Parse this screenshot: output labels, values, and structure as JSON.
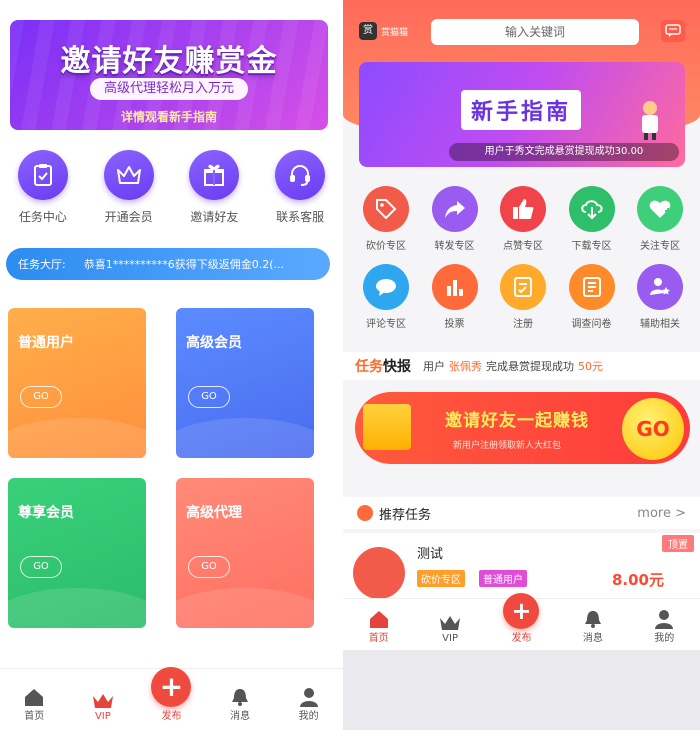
{
  "left": {
    "banner": {
      "title": "邀请好友赚赏金",
      "subtitle": "高级代理轻松月入万元",
      "hint": "详情观看新手指南"
    },
    "features": [
      {
        "label": "任务中心",
        "icon": "clipboard-icon"
      },
      {
        "label": "开通会员",
        "icon": "crown-icon"
      },
      {
        "label": "邀请好友",
        "icon": "gift-icon"
      },
      {
        "label": "联系客服",
        "icon": "headset-icon"
      }
    ],
    "ticker": {
      "label": "任务大厅:",
      "text": "恭喜1**********6获得下级返佣金0.2(..."
    },
    "cards": [
      {
        "title": "普通用户",
        "button": "GO"
      },
      {
        "title": "高级会员",
        "button": "GO"
      },
      {
        "title": "尊享会员",
        "button": "GO"
      },
      {
        "title": "高级代理",
        "button": "GO"
      }
    ],
    "tabbar": [
      {
        "label": "首页",
        "icon": "home-icon"
      },
      {
        "label": "VIP",
        "icon": "crown-icon"
      },
      {
        "label": "发布",
        "icon": "plus-icon"
      },
      {
        "label": "消息",
        "icon": "bell-icon"
      },
      {
        "label": "我的",
        "icon": "user-icon"
      }
    ]
  },
  "right": {
    "header": {
      "logo_badge": "赏",
      "logo_text": "赏猫猫",
      "search_placeholder": "输入关键词"
    },
    "banner": {
      "title": "新手指南",
      "notice": "用户于秀文完成悬赏提现成功30.00"
    },
    "categories_row1": [
      {
        "label": "砍价专区",
        "icon": "tag-icon",
        "color": "#f25a4a"
      },
      {
        "label": "转发专区",
        "icon": "share-icon",
        "color": "#9a5cf0"
      },
      {
        "label": "点赞专区",
        "icon": "thumbs-up-icon",
        "color": "#f0434a"
      },
      {
        "label": "下载专区",
        "icon": "download-icon",
        "color": "#2fbf6a"
      },
      {
        "label": "关注专区",
        "icon": "heart-plus-icon",
        "color": "#3fcf7a"
      }
    ],
    "categories_row2": [
      {
        "label": "评论专区",
        "icon": "comment-icon",
        "color": "#2fa7f0"
      },
      {
        "label": "投票",
        "icon": "bar-chart-icon",
        "color": "#ff6a3a"
      },
      {
        "label": "注册",
        "icon": "form-icon",
        "color": "#ffaa2a"
      },
      {
        "label": "调查问卷",
        "icon": "survey-icon",
        "color": "#ff8a2a"
      },
      {
        "label": "辅助相关",
        "icon": "star-user-icon",
        "color": "#9a5cf0"
      }
    ],
    "express": {
      "title_a": "任务",
      "title_b": "快报",
      "user_label": "用户",
      "user_name": "张佩秀",
      "message": "完成悬赏提现成功",
      "amount": "50元"
    },
    "invite": {
      "text": "邀请好友一起赚钱",
      "sub": "新用户注册领取新人大红包",
      "go": "GO"
    },
    "recommend": {
      "title": "推荐任务",
      "more": "more >"
    },
    "task": {
      "name": "测试",
      "tag1": "砍价专区",
      "tag2": "普通用户",
      "price": "8.00元",
      "top": "顶置"
    },
    "tabbar": [
      {
        "label": "首页",
        "icon": "home-icon"
      },
      {
        "label": "VIP",
        "icon": "crown-icon"
      },
      {
        "label": "发布",
        "icon": "plus-icon"
      },
      {
        "label": "消息",
        "icon": "bell-icon"
      },
      {
        "label": "我的",
        "icon": "user-icon"
      }
    ]
  }
}
